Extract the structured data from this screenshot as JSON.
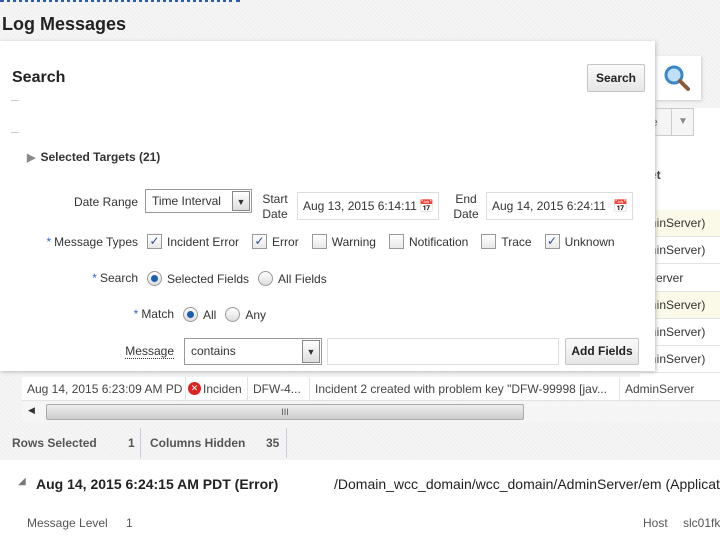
{
  "page": {
    "title": "Log Messages"
  },
  "search": {
    "heading": "Search",
    "search_button": "Search",
    "selected_targets": "Selected Targets (21)",
    "date_range": {
      "label": "Date Range",
      "value": "Time Interval",
      "start_label_1": "Start",
      "start_label_2": "Date",
      "start_value": "Aug 13, 2015 6:14:11",
      "end_label_1": "End",
      "end_label_2": "Date",
      "end_value": "Aug 14, 2015 6:24:11"
    },
    "message_types": {
      "label": "Message Types",
      "required": "*",
      "options": [
        {
          "label": "Incident Error",
          "checked": true
        },
        {
          "label": "Error",
          "checked": true
        },
        {
          "label": "Warning",
          "checked": false
        },
        {
          "label": "Notification",
          "checked": false
        },
        {
          "label": "Trace",
          "checked": false
        },
        {
          "label": "Unknown",
          "checked": true
        }
      ]
    },
    "search_scope": {
      "label": "Search",
      "required": "*",
      "options": [
        {
          "label": "Selected Fields",
          "selected": true
        },
        {
          "label": "All Fields",
          "selected": false
        }
      ]
    },
    "match": {
      "label": "Match",
      "required": "*",
      "options": [
        {
          "label": "All",
          "selected": true
        },
        {
          "label": "Any",
          "selected": false
        }
      ]
    },
    "message": {
      "label": "Message",
      "operator": "contains",
      "value": "",
      "add_fields": "Add Fields"
    }
  },
  "background": {
    "header_fragment": "et",
    "button_fragment": "e",
    "cells": [
      "dminServer)",
      "dminServer)",
      "Server",
      "dminServer)",
      "dminServer)",
      "dminServer)"
    ]
  },
  "table_row": {
    "time": "Aug 14, 2015 6:23:09 AM PD",
    "type": "Inciden",
    "id": "DFW-4...",
    "message": "Incident 2 created with problem key \"DFW-99998 [jav...",
    "target": "AdminServer"
  },
  "status": {
    "rows_selected_label": "Rows Selected",
    "rows_selected": "1",
    "columns_hidden_label": "Columns Hidden",
    "columns_hidden": "35"
  },
  "detail": {
    "heading": "Aug 14, 2015 6:24:15 AM PDT (Error)",
    "path": "/Domain_wcc_domain/wcc_domain/AdminServer/em (Applicat",
    "level_label": "Message Level",
    "level": "1",
    "host_label": "Host",
    "host": "slc01fk"
  }
}
